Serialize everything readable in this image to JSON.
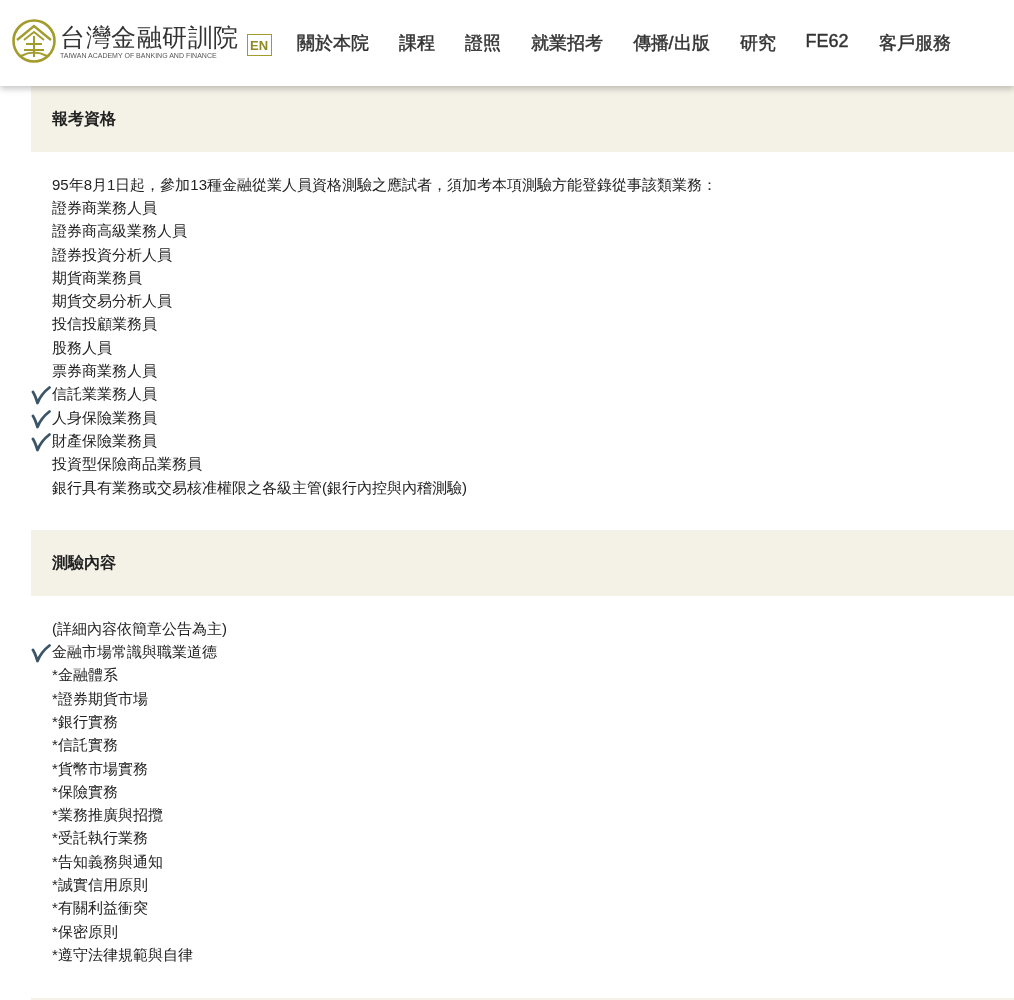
{
  "header": {
    "logo": {
      "title": "台灣金融研訓院",
      "subtitle": "TAIWAN ACADEMY OF BANKING AND FINANCE"
    },
    "language_button": "EN",
    "nav": [
      "關於本院",
      "課程",
      "證照",
      "就業招考",
      "傳播/出版",
      "研究",
      "FE62",
      "客戶服務"
    ]
  },
  "sections": [
    {
      "title": "報考資格",
      "intro": "95年8月1日起，參加13種金融從業人員資格測驗之應試者，須加考本項測驗方能登錄從事該類業務：",
      "items": [
        {
          "text": "證券商業務人員",
          "checked": false
        },
        {
          "text": "證券商高級業務人員",
          "checked": false
        },
        {
          "text": "證券投資分析人員",
          "checked": false
        },
        {
          "text": "期貨商業務員",
          "checked": false
        },
        {
          "text": "期貨交易分析人員",
          "checked": false
        },
        {
          "text": "投信投顧業務員",
          "checked": false
        },
        {
          "text": "股務人員",
          "checked": false
        },
        {
          "text": "票券商業務人員",
          "checked": false
        },
        {
          "text": "信託業業務人員",
          "checked": true
        },
        {
          "text": "人身保險業務員",
          "checked": true
        },
        {
          "text": "財產保險業務員",
          "checked": true
        },
        {
          "text": "投資型保險商品業務員",
          "checked": false
        },
        {
          "text": "銀行具有業務或交易核准權限之各級主管(銀行內控與內稽測驗)",
          "checked": false
        }
      ]
    },
    {
      "title": "測驗內容",
      "intro": "(詳細內容依簡章公告為主)",
      "items": [
        {
          "text": "金融市場常識與職業道德",
          "checked": true
        },
        {
          "text": "*金融體系",
          "checked": false
        },
        {
          "text": "*證券期貨市場",
          "checked": false
        },
        {
          "text": "*銀行實務",
          "checked": false
        },
        {
          "text": "*信託實務",
          "checked": false
        },
        {
          "text": "*貨幣市場實務",
          "checked": false
        },
        {
          "text": "*保險實務",
          "checked": false
        },
        {
          "text": "*業務推廣與招攬",
          "checked": false
        },
        {
          "text": "*受託執行業務",
          "checked": false
        },
        {
          "text": "*告知義務與通知",
          "checked": false
        },
        {
          "text": "*誠實信用原則",
          "checked": false
        },
        {
          "text": "*有關利益衝突",
          "checked": false
        },
        {
          "text": "*保密原則",
          "checked": false
        },
        {
          "text": "*遵守法律規範與自律",
          "checked": false
        }
      ]
    }
  ]
}
